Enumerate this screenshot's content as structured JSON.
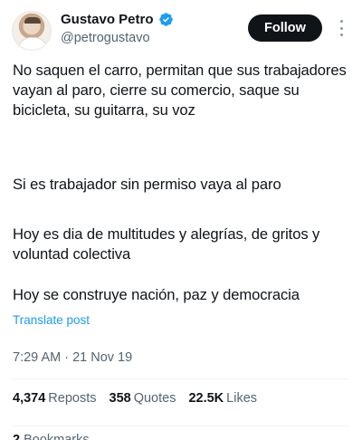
{
  "author": {
    "name": "Gustavo Petro",
    "handle": "@petrogustavo"
  },
  "header": {
    "follow_label": "Follow"
  },
  "tweet": {
    "paragraphs": [
      "No saquen el carro, permitan que sus trabajadores vayan al paro, cierre su comercio, saque su bicicleta, su guitarra, su voz",
      "Si es trabajador sin permiso vaya al paro",
      "Hoy es dia de multitudes y alegrías, de gritos y voluntad colectiva",
      "Hoy se construye nación, paz y democracia"
    ],
    "translate_label": "Translate post",
    "timestamp": "7:29 AM · 21 Nov 19"
  },
  "stats": {
    "reposts": {
      "value": "4,374",
      "label": "Reposts"
    },
    "quotes": {
      "value": "358",
      "label": "Quotes"
    },
    "likes": {
      "value": "22.5K",
      "label": "Likes"
    },
    "bookmarks": {
      "value": "2",
      "label": "Bookmarks"
    }
  },
  "colors": {
    "accent": "#1d9bf0",
    "verified": "#1d9bf0",
    "follow_bg": "#0f1419",
    "secondary_text": "#536471"
  },
  "icons": [
    "verified-badge-icon",
    "more-options-icon"
  ]
}
